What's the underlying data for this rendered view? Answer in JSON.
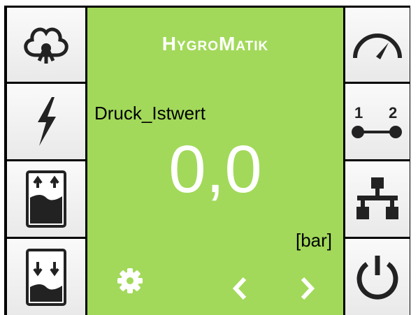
{
  "header": {
    "brand_first": "H",
    "brand_mid": "YGRO",
    "brand_m": "M",
    "brand_rest": "ATIK"
  },
  "display": {
    "parameter_name": "Druck_Istwert",
    "value": "0,0",
    "unit": "[bar]"
  },
  "left_menu": [
    {
      "icon": "steam-cloud-icon"
    },
    {
      "icon": "lightning-icon"
    },
    {
      "icon": "tank-fill-icon"
    },
    {
      "icon": "tank-drain-icon"
    }
  ],
  "right_menu": [
    {
      "icon": "gauge-icon"
    },
    {
      "icon": "step-1-2-icon",
      "labels": [
        "1",
        "2"
      ]
    },
    {
      "icon": "network-icon"
    },
    {
      "icon": "power-icon"
    }
  ],
  "bottom": [
    {
      "icon": "gear-icon"
    },
    {
      "icon": "chevron-left-icon"
    },
    {
      "icon": "chevron-right-icon"
    }
  ],
  "colors": {
    "display_bg": "#a2d95a",
    "icon": "#222222",
    "value_text": "#ffffff"
  }
}
